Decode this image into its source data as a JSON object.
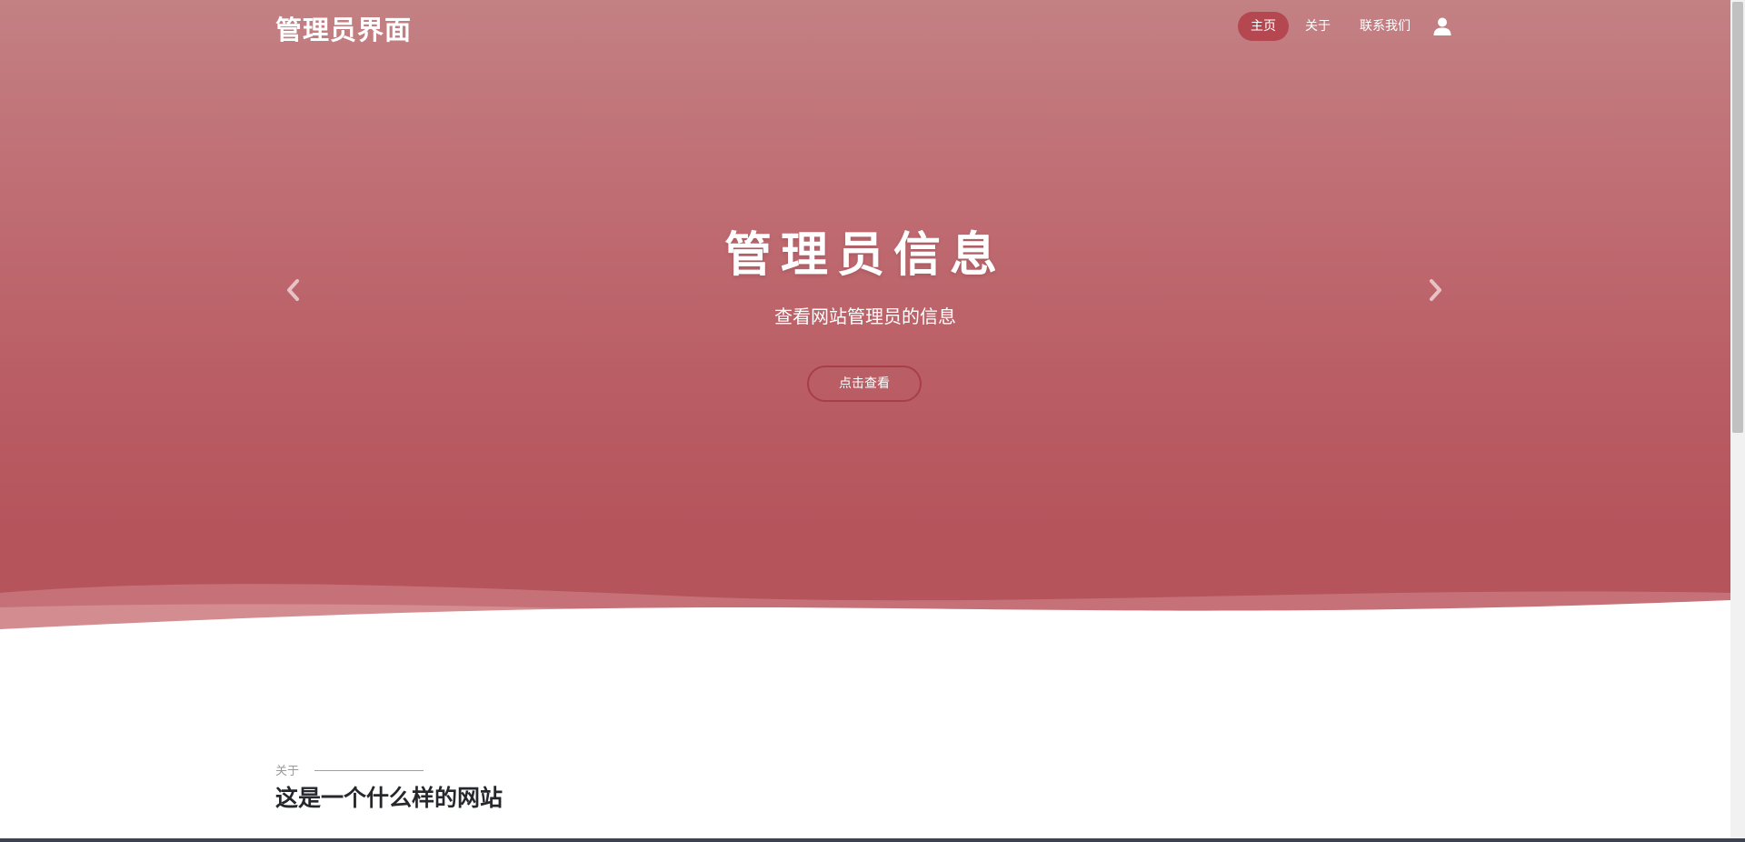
{
  "header": {
    "logo": "管理员界面",
    "nav": [
      {
        "label": "主页",
        "active": true
      },
      {
        "label": "关于",
        "active": false
      },
      {
        "label": "联系我们",
        "active": false
      }
    ],
    "user_icon": "user-icon"
  },
  "hero": {
    "title": "管理员信息",
    "subtitle": "查看网站管理员的信息",
    "button": "点击查看",
    "prev_icon": "chevron-left-icon",
    "next_icon": "chevron-right-icon"
  },
  "about": {
    "label": "关于",
    "title": "这是一个什么样的网站"
  },
  "colors": {
    "hero_top": "#c38184",
    "hero_bottom": "#b5545b",
    "nav_active": "#b4474f",
    "accent_line": "#f08a4b",
    "heading": "#25272c"
  }
}
